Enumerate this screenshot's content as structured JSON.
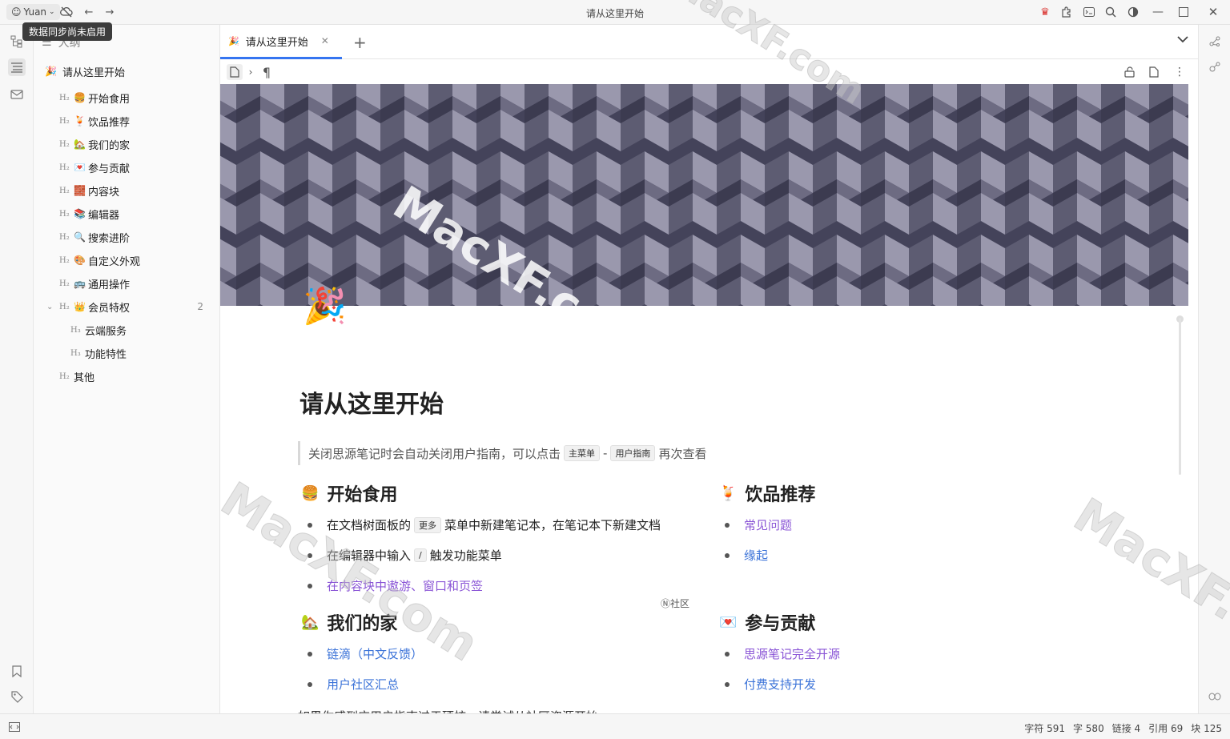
{
  "window": {
    "title": "请从这里开始",
    "user": "Yuan",
    "tooltip": "数据同步尚未启用"
  },
  "outline": {
    "header": "大纲",
    "root": "请从这里开始",
    "items": [
      {
        "level": "H2",
        "emoji": "🍔",
        "label": "开始食用"
      },
      {
        "level": "H2",
        "emoji": "🍹",
        "label": "饮品推荐"
      },
      {
        "level": "H2",
        "emoji": "🏡",
        "label": "我们的家"
      },
      {
        "level": "H2",
        "emoji": "💌",
        "label": "参与贡献"
      },
      {
        "level": "H2",
        "emoji": "🧱",
        "label": "内容块"
      },
      {
        "level": "H2",
        "emoji": "📚",
        "label": "编辑器"
      },
      {
        "level": "H2",
        "emoji": "🔍",
        "label": "搜索进阶"
      },
      {
        "level": "H2",
        "emoji": "🎨",
        "label": "自定义外观"
      },
      {
        "level": "H2",
        "emoji": "🚌",
        "label": "通用操作"
      },
      {
        "level": "H2",
        "emoji": "👑",
        "label": "会员特权",
        "count": "2"
      },
      {
        "level": "H3",
        "emoji": "",
        "label": "云端服务"
      },
      {
        "level": "H3",
        "emoji": "",
        "label": "功能特性"
      },
      {
        "level": "H2",
        "emoji": "",
        "label": "其他"
      }
    ]
  },
  "tabs": [
    {
      "label": "请从这里开始",
      "emoji": "🎉"
    }
  ],
  "doc": {
    "emoji": "🎉",
    "title": "请从这里开始",
    "quote": {
      "text": "关闭思源笔记时会自动关闭用户指南，可以点击",
      "kbd1": "主菜单",
      "sep": "-",
      "kbd2": "用户指南",
      "tail": "再次查看"
    },
    "sections": {
      "start": {
        "emoji": "🍔",
        "title": "开始食用",
        "item1_a": "在文档树面板的",
        "item1_kbd": "更多",
        "item1_b": "菜单中新建笔记本，在笔记本下新建文档",
        "item2_a": "在编辑器中输入",
        "item2_kbd": "/",
        "item2_b": "触发功能菜单",
        "item3": "在内容块中遨游、窗口和页签"
      },
      "drinks": {
        "emoji": "🍹",
        "title": "饮品推荐",
        "item1": "常见问题",
        "item2": "缘起"
      },
      "home": {
        "emoji": "🏡",
        "title": "我们的家",
        "item1": "链滴（中文反馈）",
        "item2": "用户社区汇总"
      },
      "contribute": {
        "emoji": "💌",
        "title": "参与贡献",
        "item1": "思源笔记完全开源",
        "item2": "付费支持开发"
      }
    },
    "community_badge": "Ⓝ社区",
    "cut_line": "如果你感到应用启指南过于硬核，请尝试从社区资源开始"
  },
  "status": {
    "chars": "字符 591",
    "words": "字 580",
    "links": "链接 4",
    "refs": "引用 69",
    "blocks": "块 125"
  },
  "watermark": "MacXF.com",
  "colors": {
    "accent": "#3575f0",
    "link_blue": "#3a72d8",
    "link_purple": "#8a55d6",
    "crown_red": "#d9302c"
  }
}
